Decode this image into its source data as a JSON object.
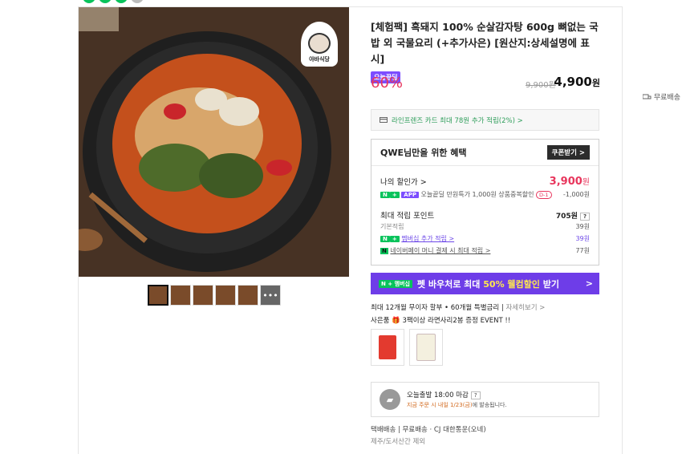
{
  "product": {
    "title": "[체험팩] 흑돼지 100% 순살감자탕 600g 뼈없는 국밥 외 국물요리 (+추가사은) [원산지:상세설명에 표시]",
    "badge": "오늘끝딜",
    "logo_text": "야바식당"
  },
  "price": {
    "discount_rate": "60%",
    "original": "9,900원",
    "sale_amount": "4,900",
    "sale_unit": "원",
    "shipping": "무료배송"
  },
  "card_promo": "라인프렌즈 카드 최대 78원 추가 적립(2%) >",
  "benefit": {
    "header": "QWE님만을 위한 혜택",
    "coupon_button": "쿠폰받기 >",
    "my_price_label": "나의 할인가 >",
    "my_price_amount": "3,900",
    "my_price_unit": "원",
    "tag_n": "N",
    "tag_plus": "+",
    "tag_app": "APP",
    "deal_text": "오늘끝딜 만원특가 1,000원 상품중복할인",
    "dday": "D-1",
    "deal_amount": "-1,000원",
    "points_label": "최대 적립 포인트",
    "points_total": "705원",
    "qmark": "?",
    "basic_label": "기본적립",
    "basic_value": "39원",
    "membership_label": "멤버십 추가 적립 >",
    "membership_value": "39원",
    "npay_tag": "N",
    "npay_label": "네이버페이 머니 결제 시 최대 적립 >",
    "npay_value": "77원"
  },
  "banner": {
    "tag": "N + 멤버십",
    "text_prefix": "펫 바우처로 최대",
    "highlight": "50% 웰컴할인",
    "text_suffix": "받기",
    "arrow": ">"
  },
  "installment": {
    "text": "최대 12개월 무이자 할부 • 60개월 특별금리",
    "link": "자세히보기 >"
  },
  "gift": {
    "label": "사은품",
    "text": "3팩이상 라면사리2봉 증정 EVENT !!"
  },
  "delivery": {
    "title": "오늘출발 18:00 마감",
    "qmark": "?",
    "detail_prefix": "지금 주문 시 내일 1/23(금)",
    "detail_suffix": "에 발송됩니다."
  },
  "footer": {
    "line1": "택배배송  |  무료배송 · CJ 대한통운(오네)",
    "line2": "제주/도서산간 제외"
  },
  "thumbnails": {
    "more_icon": "•••"
  },
  "colors": {
    "accent_red": "#e8355c",
    "naver_green": "#08c35b",
    "purple": "#6e3de8"
  }
}
